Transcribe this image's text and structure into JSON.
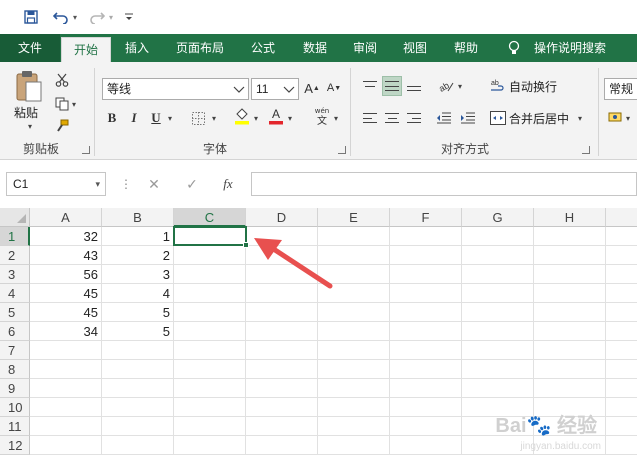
{
  "qat": {
    "save_icon": "save-icon",
    "undo_icon": "undo-icon",
    "redo_icon": "redo-icon",
    "customize_icon": "customize-quick-access-icon"
  },
  "tabs": [
    {
      "label": "文件"
    },
    {
      "label": "开始"
    },
    {
      "label": "插入"
    },
    {
      "label": "页面布局"
    },
    {
      "label": "公式"
    },
    {
      "label": "数据"
    },
    {
      "label": "审阅"
    },
    {
      "label": "视图"
    },
    {
      "label": "帮助"
    },
    {
      "label": "操作说明搜索"
    }
  ],
  "ribbon": {
    "clipboard": {
      "paste_label": "粘贴",
      "group_label": "剪贴板"
    },
    "font": {
      "font_name": "等线",
      "font_size": "11",
      "group_label": "字体"
    },
    "alignment": {
      "wrap_text": "自动换行",
      "merge_center": "合并后居中",
      "group_label": "对齐方式"
    },
    "number": {
      "format": "常规"
    }
  },
  "formula_bar": {
    "name_box": "C1",
    "cancel_glyph": "✕",
    "enter_glyph": "✓",
    "fx_label": "fx",
    "formula": ""
  },
  "sheet": {
    "columns": [
      "A",
      "B",
      "C",
      "D",
      "E",
      "F",
      "G",
      "H"
    ],
    "rows": [
      "1",
      "2",
      "3",
      "4",
      "5",
      "6",
      "7",
      "8",
      "9",
      "10",
      "11",
      "12"
    ],
    "col_a": [
      "32",
      "43",
      "56",
      "45",
      "45",
      "34"
    ],
    "col_b": [
      "1",
      "2",
      "3",
      "4",
      "5",
      "5"
    ],
    "active_cell": "C1"
  },
  "watermark": {
    "text": "Bai",
    "text2": "经验",
    "url": "jingyan.baidu.com"
  },
  "colors": {
    "accent": "#217346",
    "arrow": "#e8504f"
  }
}
